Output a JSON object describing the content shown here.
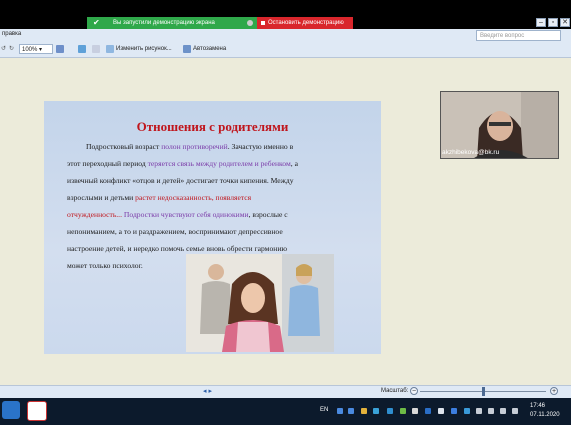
{
  "share_banner": {
    "status_text": "Вы запустили демонстрацию экрана",
    "stop_button": "Остановить демонстрацию"
  },
  "app": {
    "menu_help": "правка",
    "search_placeholder": "Введите вопрос",
    "zoom_value": "100%",
    "change_picture": "Изменить рисунок...",
    "autoshape": "Автозамена"
  },
  "slide": {
    "title": "Отношения с родителями",
    "line1a": "Подростковый возраст ",
    "line1b": "полон противоречий",
    "line1c": ". Зачастую именно в",
    "line2a": "этот переходный период ",
    "line2b": "теряется связь между родителем и ребенком",
    "line2c": ", а",
    "line3": "извечный конфликт «отцов и детей» достигает точки кипения. Между",
    "line4a": "взрослыми и детьми ",
    "line4b": "растет недосказанность, появляется",
    "line5a": "отчужденность...",
    "line5b": " Подростки чувствуют себя одинокими",
    "line5c": ", взрослые с",
    "line6": "непониманием, а то и раздражением, воспринимают депрессивное",
    "line7": "настроение детей, и нередко помочь семье вновь обрести гармонию",
    "line8": "может только психолог."
  },
  "webcam": {
    "email": "akzhibekova@bk.ru"
  },
  "statusbar": {
    "zoom_label": "Масштаб:",
    "zoom_level_fraction": 0.5
  },
  "taskbar": {
    "language": "EN",
    "time": "17:46",
    "date": "07.11.2020"
  }
}
